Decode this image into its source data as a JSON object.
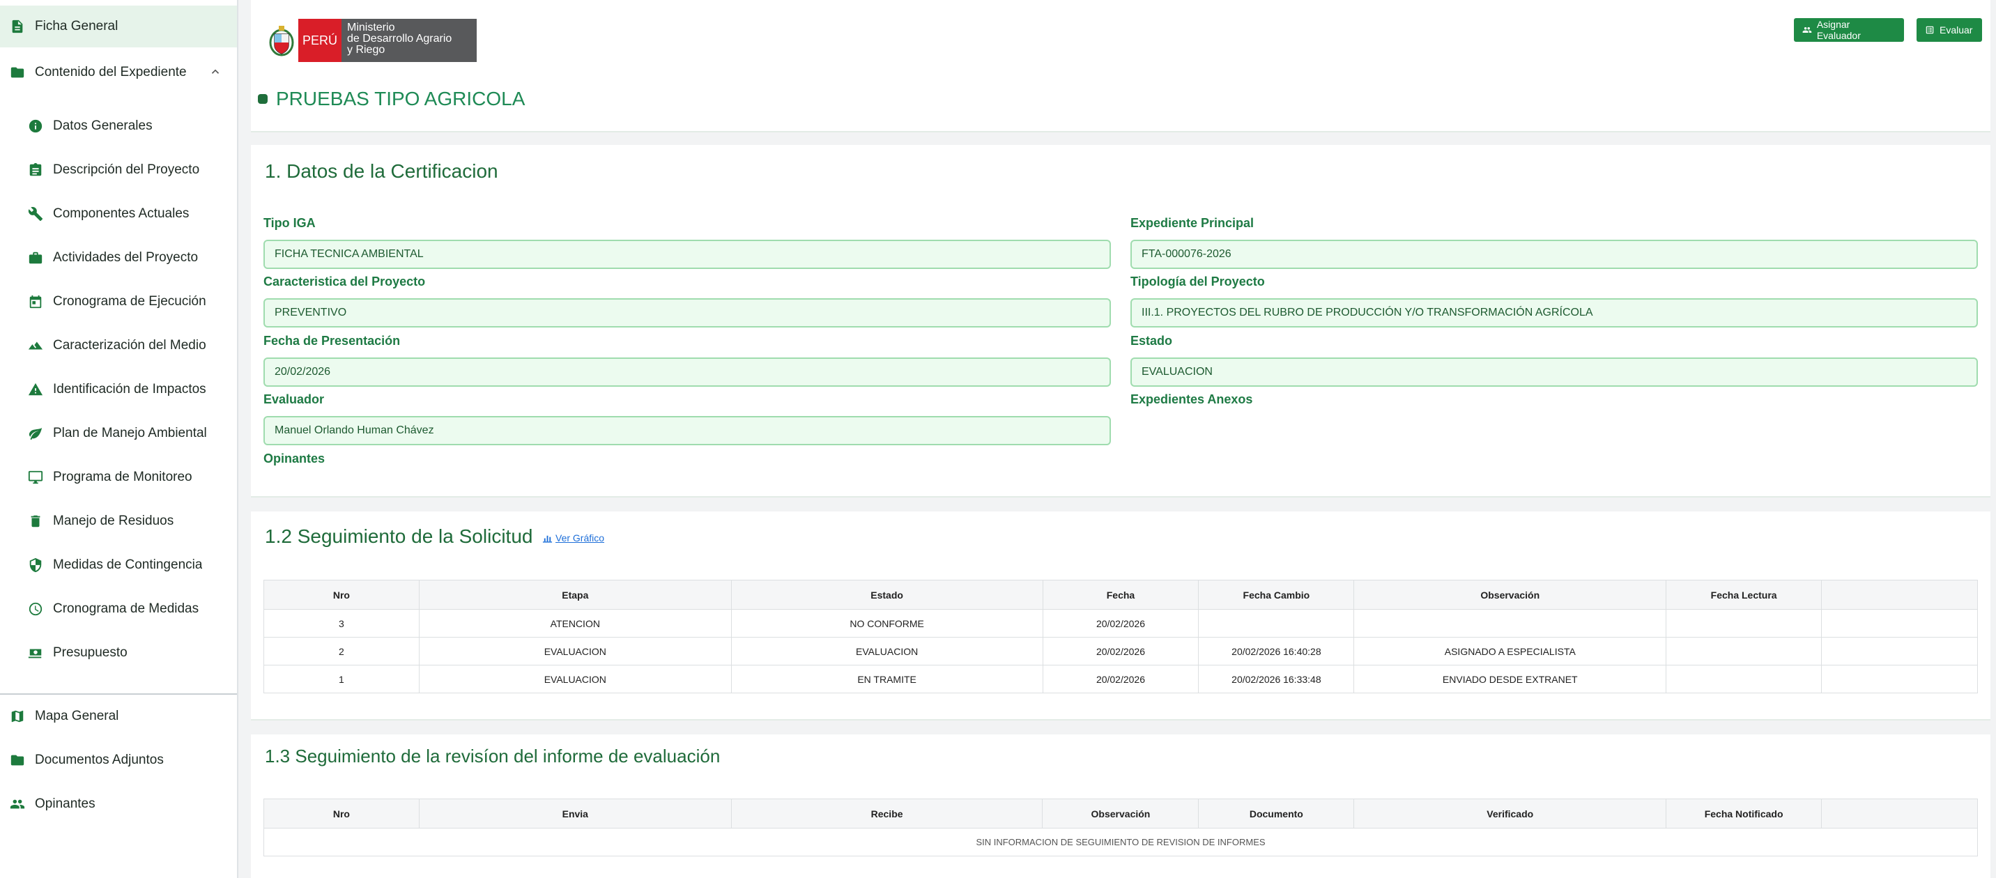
{
  "sidebar": {
    "top_items": [
      {
        "label": "Ficha General",
        "icon": "document-icon"
      },
      {
        "label": "Contenido del Expediente",
        "icon": "folder-icon"
      }
    ],
    "sub_items": [
      {
        "label": "Datos Generales",
        "icon": "info-icon"
      },
      {
        "label": "Descripción del Proyecto",
        "icon": "clipboard-icon"
      },
      {
        "label": "Componentes Actuales",
        "icon": "wrench-icon"
      },
      {
        "label": "Actividades del Proyecto",
        "icon": "briefcase-icon"
      },
      {
        "label": "Cronograma de Ejecución",
        "icon": "calendar-icon"
      },
      {
        "label": "Caracterización del Medio",
        "icon": "terrain-icon"
      },
      {
        "label": "Identificación de Impactos",
        "icon": "warning-icon"
      },
      {
        "label": "Plan de Manejo Ambiental",
        "icon": "leaf-icon"
      },
      {
        "label": "Programa de Monitoreo",
        "icon": "monitor-icon"
      },
      {
        "label": "Manejo de Residuos",
        "icon": "trash-icon"
      },
      {
        "label": "Medidas de Contingencia",
        "icon": "shield-icon"
      },
      {
        "label": "Cronograma de Medidas",
        "icon": "clock-icon"
      },
      {
        "label": "Presupuesto",
        "icon": "money-icon"
      }
    ],
    "bottom_items": [
      {
        "label": "Mapa General",
        "icon": "map-icon"
      },
      {
        "label": "Documentos Adjuntos",
        "icon": "folder-icon"
      },
      {
        "label": "Opinantes",
        "icon": "people-icon"
      }
    ]
  },
  "header": {
    "logo": {
      "country": "PERÚ",
      "line1": "Ministerio",
      "line2": "de Desarrollo Agrario",
      "line3": "y Riego"
    },
    "assign_button": "Asignar Evaluador",
    "evaluate_button": "Evaluar",
    "project_title": "PRUEBAS TIPO AGRICOLA"
  },
  "certification": {
    "title": "1. Datos de la Certificacion",
    "fields": {
      "tipo_iga": {
        "label": "Tipo IGA",
        "value": "FICHA TECNICA AMBIENTAL"
      },
      "expediente_principal": {
        "label": "Expediente Principal",
        "value": "FTA-000076-2026"
      },
      "caracteristica": {
        "label": "Caracteristica del Proyecto",
        "value": "PREVENTIVO"
      },
      "tipologia": {
        "label": "Tipología del Proyecto",
        "value": "III.1. PROYECTOS DEL RUBRO DE PRODUCCIÓN Y/O TRANSFORMACIÓN AGRÍCOLA"
      },
      "fecha_presentacion": {
        "label": "Fecha de Presentación",
        "value": "20/02/2026"
      },
      "estado": {
        "label": "Estado",
        "value": "EVALUACION"
      },
      "evaluador": {
        "label": "Evaluador",
        "value": "Manuel Orlando Human Chávez"
      },
      "expedientes_anexos": {
        "label": "Expedientes Anexos"
      },
      "opinantes": {
        "label": "Opinantes"
      }
    }
  },
  "tracking": {
    "title": "1.2 Seguimiento de la Solicitud",
    "chart_link": "Ver Gráfico",
    "columns": [
      "Nro",
      "Etapa",
      "Estado",
      "Fecha",
      "Fecha Cambio",
      "Observación",
      "Fecha Lectura",
      ""
    ],
    "rows": [
      [
        "3",
        "ATENCION",
        "NO CONFORME",
        "20/02/2026",
        "",
        "",
        "",
        ""
      ],
      [
        "2",
        "EVALUACION",
        "EVALUACION",
        "20/02/2026",
        "20/02/2026 16:40:28",
        "ASIGNADO A ESPECIALISTA",
        "",
        ""
      ],
      [
        "1",
        "EVALUACION",
        "EN TRAMITE",
        "20/02/2026",
        "20/02/2026 16:33:48",
        "ENVIADO DESDE EXTRANET",
        "",
        ""
      ]
    ]
  },
  "review": {
    "title": "1.3 Seguimiento de la revisíon del informe de evaluación",
    "columns": [
      "Nro",
      "Envia",
      "Recibe",
      "Observación",
      "Documento",
      "Verificado",
      "Fecha Notificado",
      ""
    ],
    "empty_message": "SIN INFORMACION DE SEGUIMIENTO DE REVISION DE INFORMES"
  },
  "colors": {
    "accent": "#1e8a45",
    "title": "#1f6b3a",
    "input_bg": "#ecfbef",
    "input_border": "#9fdcae"
  }
}
